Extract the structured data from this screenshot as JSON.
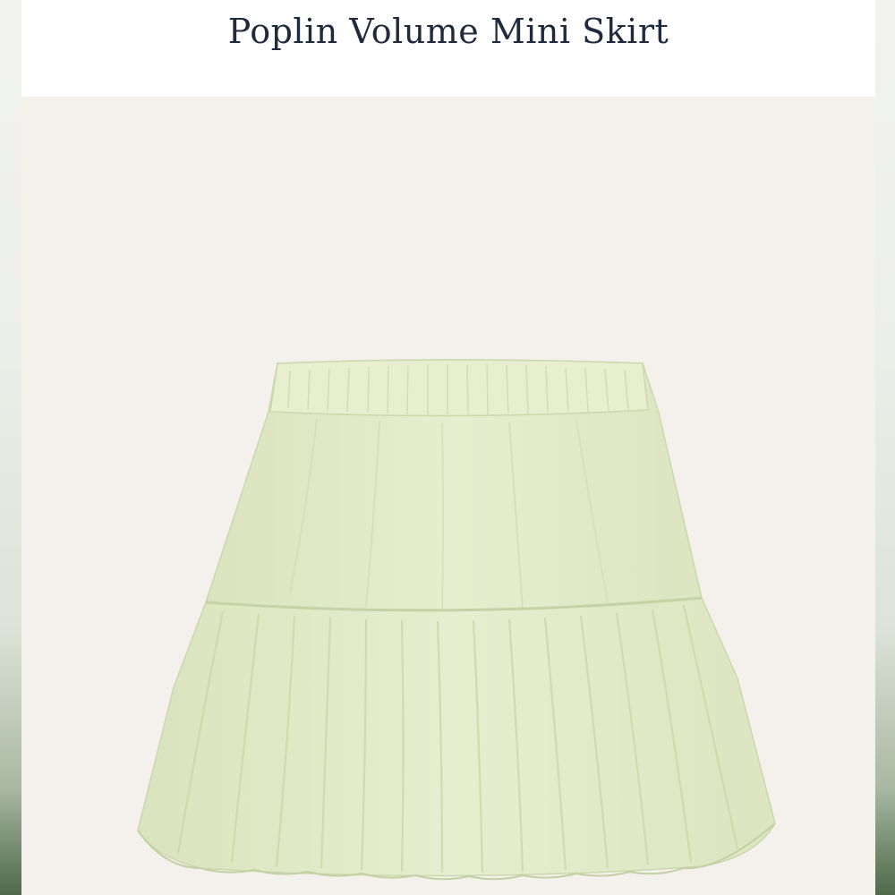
{
  "product": {
    "title": "Poplin Volume Mini Skirt"
  },
  "colors": {
    "title_text": "#1f2a3c",
    "image_background": "#f4f1ec",
    "skirt_fill": "#e3eccb"
  },
  "icons": {
    "product_photo": "skirt-photo"
  }
}
